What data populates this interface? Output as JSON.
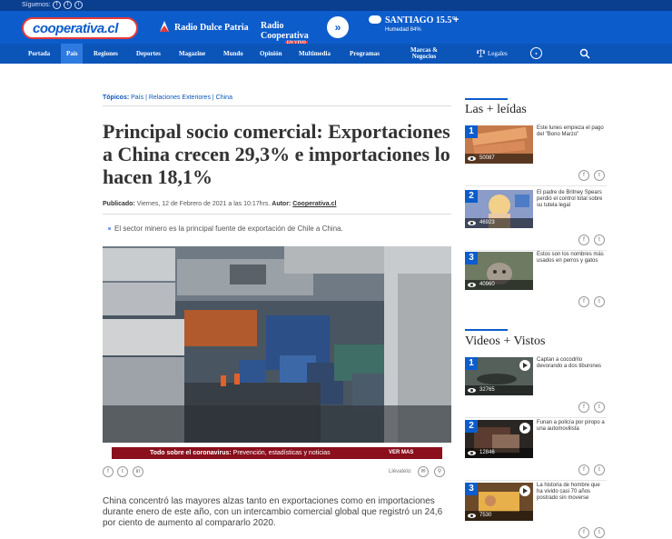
{
  "top_bar": {
    "follow_label": "Síguenos:",
    "social": [
      "f",
      "t",
      "i"
    ]
  },
  "header": {
    "logo": "cooperativa.cl",
    "radio_1": "Radio Dulce Patria",
    "radio_2": "Radio Cooperativa",
    "radio_2_badge": "EN VIVO",
    "weather_city": "SANTIAGO 15.5°",
    "weather_humidity": "Humedad 84%",
    "plus": "+"
  },
  "nav": {
    "items": [
      "Portada",
      "País",
      "Regiones",
      "Deportes",
      "Magazine",
      "Mundo",
      "Opinión",
      "Multimedia",
      "Programas"
    ],
    "brands_line1": "Marcas &",
    "brands_line2": "Negocios",
    "legales": "Legales"
  },
  "article": {
    "topics_label": "Tópicos:",
    "topics": [
      "País",
      "Relaciones Exteriores",
      "China"
    ],
    "headline": "Principal socio comercial: Exportaciones a China crecen 29,3% e importaciones lo hacen 18,1%",
    "byline_label": "Publicado:",
    "byline_date": " Viernes, 12 de Febrero de 2021 a las 10:17hrs. ",
    "author_label": "Autor:",
    "author": "Cooperativa.cl",
    "bullet": "El sector minero es la principal fuente de exportación de Chile a China.",
    "promo_bold": "Todo sobre el coronavirus:",
    "promo_rest": " Prevención, estadísticas y noticias",
    "promo_more": "VER MAS",
    "share_icons": [
      "f",
      "t",
      "in"
    ],
    "read_label": "Llévatelo:",
    "lead": "China concentró las mayores alzas tanto en exportaciones como en importaciones durante enero de este año, con un intercambio comercial global que registró un 24,6 por ciento de aumento al compararlo 2020."
  },
  "sidebar": {
    "most_read_title": "Las + leídas",
    "most_read": [
      {
        "rank": "1",
        "views": "50087",
        "text": "Este lunes empieza el pago del \"Bono Marzo\""
      },
      {
        "rank": "2",
        "views": "46923",
        "text": "El padre de Britney Spears perdió el control total sobre su tutela legal"
      },
      {
        "rank": "3",
        "views": "40960",
        "text": "Estos son los nombres más usados en perros y gatos"
      }
    ],
    "videos_title": "Videos + Vistos",
    "videos": [
      {
        "rank": "1",
        "views": "32765",
        "text": "Captan a cocodrilo devorando a dos tiburones"
      },
      {
        "rank": "2",
        "views": "12846",
        "text": "Funan a policía por piropo a una automovilista"
      },
      {
        "rank": "3",
        "views": "7530",
        "text": "La historia de hombre que ha vivido casi 70 años postrado sin moverse"
      }
    ]
  },
  "colors": {
    "header_blue": "#0d5ccb",
    "nav_blue": "#0b55b9",
    "promo_red": "#8b0f1d",
    "text_dark": "#333333"
  }
}
